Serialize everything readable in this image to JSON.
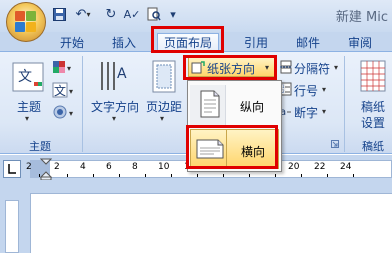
{
  "app": {
    "title": "新建 Mic"
  },
  "quick_access": {
    "save_icon": "save-icon",
    "undo_icon": "undo-icon",
    "redo_icon": "redo-icon",
    "spell_icon": "spellcheck-icon",
    "preview_icon": "print-preview-icon",
    "customize_icon": "customize-qat-icon"
  },
  "tabs": [
    {
      "label": "开始"
    },
    {
      "label": "插入"
    },
    {
      "label": "页面布局"
    },
    {
      "label": "引用"
    },
    {
      "label": "邮件"
    },
    {
      "label": "审阅"
    }
  ],
  "ribbon": {
    "theme_group": {
      "themes_label": "主题",
      "group_label": "主题"
    },
    "page_setup": {
      "text_direction_label": "文字方向",
      "margins_label": "页边距",
      "orientation_label": "纸张方向",
      "breaks_label": "分隔符",
      "line_numbers_label": "行号",
      "hyphenation_label": "断字"
    },
    "manuscript": {
      "label_line1": "稿纸",
      "label_line2": "设置",
      "group_label": "稿纸"
    }
  },
  "orientation_menu": {
    "items": [
      {
        "label": "纵向",
        "icon": "portrait-page-icon"
      },
      {
        "label": "横向",
        "icon": "landscape-page-icon"
      }
    ]
  },
  "ruler": {
    "numbers": [
      "2",
      "2",
      "4",
      "6",
      "8",
      "10",
      "12",
      "14",
      "16",
      "18",
      "20",
      "22",
      "24"
    ]
  },
  "colors": {
    "highlight": "#e00000",
    "tab_bg": "#c4d6ee",
    "text": "#15428b"
  }
}
